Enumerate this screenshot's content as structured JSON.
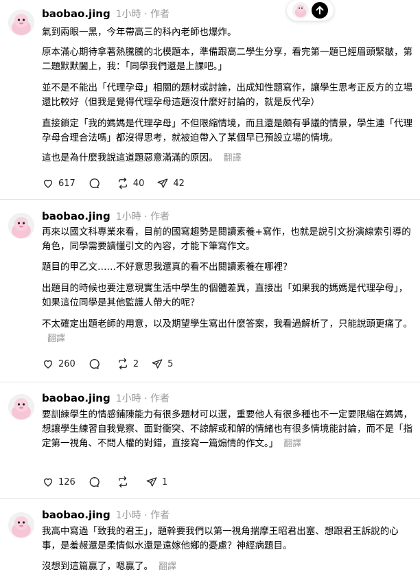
{
  "posts": [
    {
      "username": "baobao.jing",
      "meta": "1小時 · 作者",
      "paragraphs": [
        "氣到兩眼一黑，今年帶高三的科內老師也爆炸。",
        "原本滿心期待拿著熱騰騰的北模題本，準備跟高二學生分享，看完第一題已經眉頭緊皺，第二題默默闔上，我：「同學我們還是上課吧。」",
        "並不是不能出「代理孕母」相關的題材或討論，出成知性題寫作，讓學生思考正反方的立場還比較好（但我是覺得代理孕母這題沒什麼好討論的，就是反代孕）",
        "直接鎖定「我的媽媽是代理孕母」不但限縮情境，而且還是頗有爭議的情景，學生連「代理孕母合理合法嗎」都沒得思考，就被迫帶入了某個早已預設立場的情境。",
        "這也是為什麼我說這道題惡意滿滿的原因。"
      ],
      "translate_label": "翻譯",
      "likes": "617",
      "reposts": "40",
      "shares": "42"
    },
    {
      "username": "baobao.jing",
      "meta": "1小時 · 作者",
      "paragraphs": [
        "再來以國文科專業來看，目前的國寫趨勢是閱讀素養+寫作，也就是說引文扮演線索引導的角色，同學需要讀懂引文的內容，才能下筆寫作文。",
        "題目的甲乙文……不好意思我還真的看不出閱讀素養在哪裡？",
        "出題目的時候也要注意現實生活中學生的個體差異，直接出「如果我的媽媽是代理孕母」，如果這位同學是其他監護人帶大的呢？",
        "不太確定出題老師的用意，以及期望學生寫出什麼答案，我看過解析了，只能說頭更痛了。"
      ],
      "translate_label": "翻譯",
      "likes": "260",
      "reposts": "2",
      "shares": "5"
    },
    {
      "username": "baobao.jing",
      "meta": "1小時 · 作者",
      "paragraphs": [
        "要訓練學生的情感鋪陳能力有很多題材可以選，重要他人有很多種也不一定要限縮在媽媽，想讓學生練習自我覺察、面對衝突、不諒解或和解的情緒也有很多情境能討論，而不是「指定第一視角、不問人權的對錯，直接寫一篇煽情的作文。」"
      ],
      "translate_label": "翻譯",
      "likes": "126",
      "reposts": "",
      "shares": "1"
    },
    {
      "username": "baobao.jing",
      "meta": "1小時 · 作者",
      "paragraphs": [
        "我高中寫過「致我的君王」，題幹要我們以第一視角揣摩王昭君出塞、想跟君王訴說的心事，是羞赧還是柔情似水還是遠嫁他鄉的憂慮？神經病題目。",
        "沒想到這篇贏了，嗯贏了。"
      ],
      "translate_label": "翻譯"
    }
  ]
}
